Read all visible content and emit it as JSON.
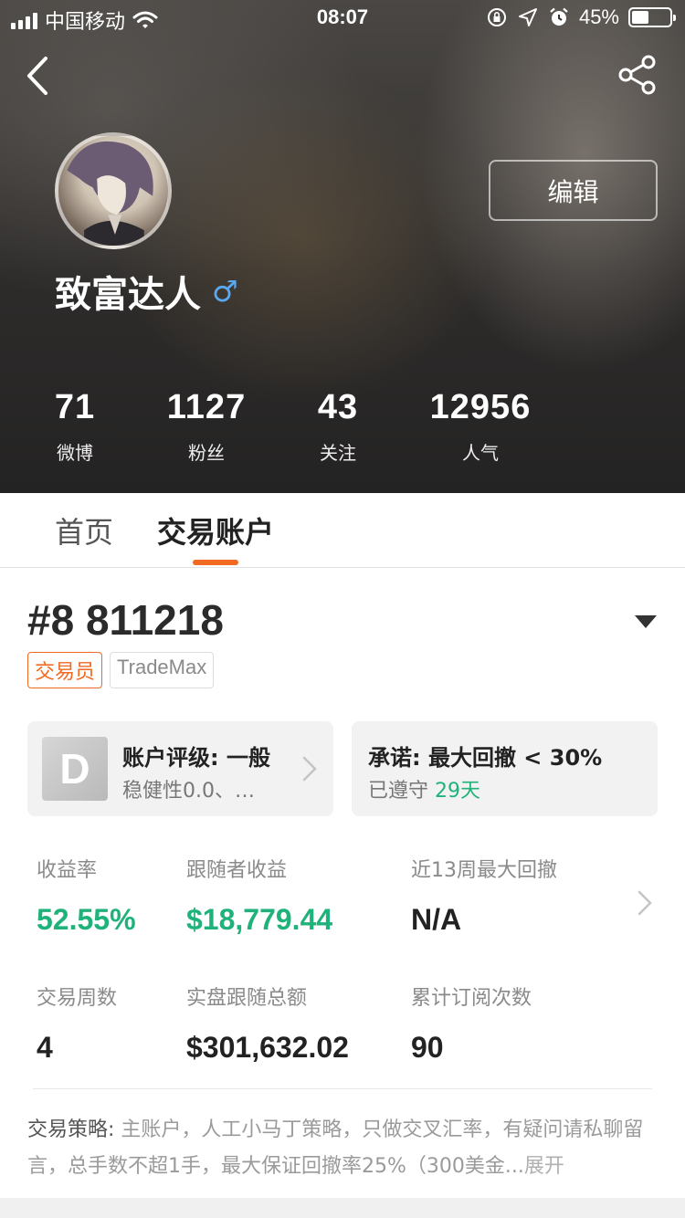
{
  "status_bar": {
    "carrier": "中国移动",
    "time": "08:07",
    "battery_percent": "45%",
    "battery_level": 0.45,
    "icons": [
      "signal-icon",
      "wifi-icon",
      "orientation-lock-icon",
      "location-icon",
      "alarm-icon",
      "battery-icon"
    ]
  },
  "header": {
    "back_icon": "chevron-left-icon",
    "share_icon": "share-icon",
    "edit_label": "编辑",
    "username": "致富达人",
    "gender_symbol": "♂",
    "stats": [
      {
        "value": "71",
        "label": "微博"
      },
      {
        "value": "1127",
        "label": "粉丝"
      },
      {
        "value": "43",
        "label": "关注"
      },
      {
        "value": "12956",
        "label": "人气"
      }
    ]
  },
  "tabs": [
    {
      "label": "首页",
      "active": false
    },
    {
      "label": "交易账户",
      "active": true
    }
  ],
  "accent_color": "#f26a21",
  "positive_color": "#1fb27a",
  "account": {
    "id": "#8 811218",
    "badges": [
      "交易员",
      "TradeMax"
    ],
    "rating_card": {
      "grade": "D",
      "title": "账户评级: 一般",
      "subtitle": "稳健性0.0、…"
    },
    "promise_card": {
      "title": "承诺: 最大回撤 < 30%",
      "status_prefix": "已遵守",
      "status_days": "29天"
    },
    "metrics": [
      {
        "label": "收益率",
        "value": "52.55%"
      },
      {
        "label": "跟随者收益",
        "value": "$18,779.44"
      },
      {
        "label": "近13周最大回撤",
        "value": "N/A"
      },
      {
        "label": "交易周数",
        "value": "4"
      },
      {
        "label": "实盘跟随总额",
        "value": "$301,632.02"
      },
      {
        "label": "累计订阅次数",
        "value": "90"
      }
    ],
    "strategy": {
      "label": "交易策略:",
      "text": " 主账户，人工小马丁策略，只做交叉汇率，有疑问请私聊留言，总手数不超1手，最大保证回撤率25%（300美金...",
      "more": "展开"
    }
  }
}
